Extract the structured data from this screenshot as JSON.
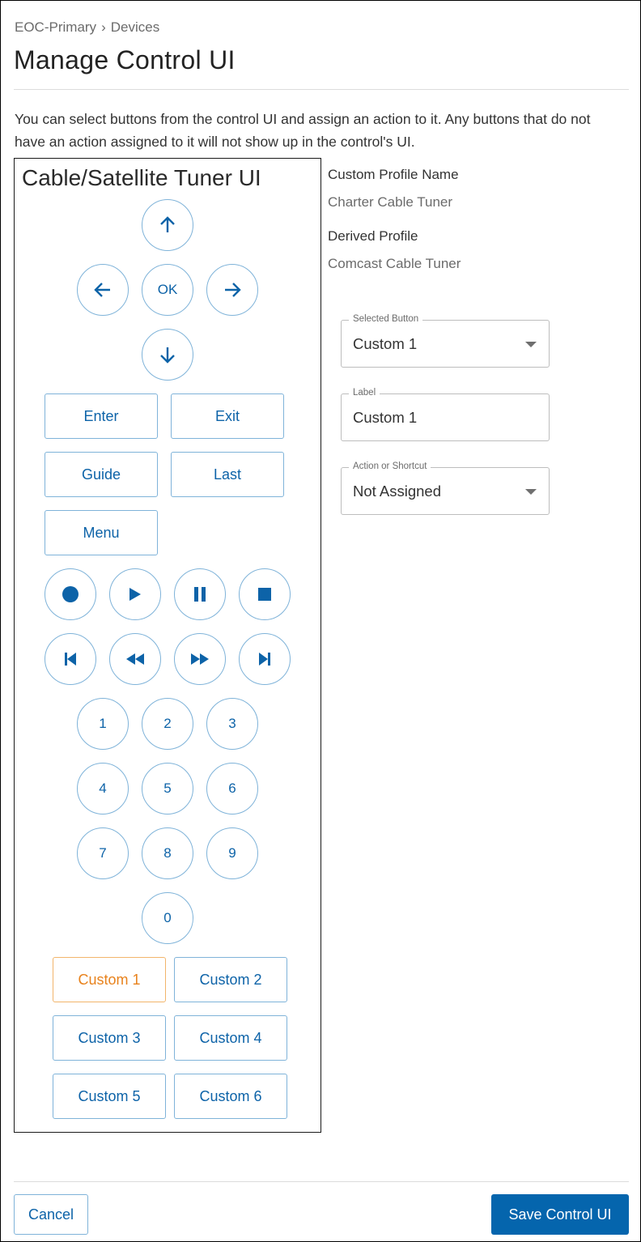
{
  "breadcrumb": {
    "items": [
      "EOC-Primary",
      "Devices"
    ],
    "separator": "›"
  },
  "page_title": "Manage Control UI",
  "description": "You can select buttons from the control UI and assign an action to it. Any buttons that do not have an action assigned to it will not show up in the control's UI.",
  "remote": {
    "title": "Cable/Satellite Tuner UI",
    "dpad": {
      "up": "up-arrow",
      "left": "left-arrow",
      "ok": "OK",
      "right": "right-arrow",
      "down": "down-arrow"
    },
    "menu_buttons": [
      "Enter",
      "Exit",
      "Guide",
      "Last",
      "Menu"
    ],
    "transport_icons": [
      "record",
      "play",
      "pause",
      "stop",
      "skip-previous",
      "rewind",
      "fast-forward",
      "skip-next"
    ],
    "number_buttons": [
      "1",
      "2",
      "3",
      "4",
      "5",
      "6",
      "7",
      "8",
      "9",
      "0"
    ],
    "custom_buttons": [
      "Custom 1",
      "Custom 2",
      "Custom 3",
      "Custom 4",
      "Custom 5",
      "Custom 6"
    ],
    "selected_button": "Custom 1"
  },
  "profile": {
    "custom_profile_label": "Custom Profile Name",
    "custom_profile_value": "Charter Cable Tuner",
    "derived_profile_label": "Derived Profile",
    "derived_profile_value": "Comcast Cable Tuner"
  },
  "form": {
    "selected_button": {
      "label": "Selected Button",
      "value": "Custom 1"
    },
    "label": {
      "label": "Label",
      "value": "Custom 1"
    },
    "action": {
      "label": "Action or Shortcut",
      "value": "Not Assigned"
    }
  },
  "footer": {
    "cancel_label": "Cancel",
    "save_label": "Save Control UI"
  },
  "colors": {
    "accent": "#0565ad",
    "button_text": "#0d63a8",
    "button_border": "#7fb3d9",
    "selected": "#e8821c"
  }
}
